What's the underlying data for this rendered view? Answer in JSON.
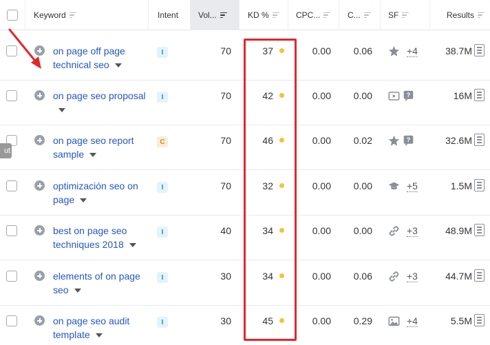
{
  "columns": {
    "keyword": "Keyword",
    "intent": "Intent",
    "volume": "Vol...",
    "kd": "KD %",
    "cpc": "CPC...",
    "competition": "C...",
    "sf": "SF",
    "results": "Results"
  },
  "side_tab_label": "ut",
  "kd_dot_color": "#f5c431",
  "highlight_color": "#e4262c",
  "rows": [
    {
      "keyword": "on page off page technical seo",
      "intent": "I",
      "volume": "70",
      "kd": "37",
      "cpc": "0.00",
      "competition": "0.06",
      "sf_icons": [
        "star-icon"
      ],
      "sf_count": "+4",
      "results": "38.7M"
    },
    {
      "keyword": "on page seo proposal",
      "intent": "I",
      "volume": "70",
      "kd": "42",
      "cpc": "0.00",
      "competition": "0.00",
      "sf_icons": [
        "video-icon",
        "faq-icon"
      ],
      "sf_count": "",
      "results": "16M"
    },
    {
      "keyword": "on page seo report sample",
      "intent": "C",
      "volume": "70",
      "kd": "46",
      "cpc": "0.00",
      "competition": "0.02",
      "sf_icons": [
        "star-icon",
        "faq-icon"
      ],
      "sf_count": "",
      "results": "32.6M"
    },
    {
      "keyword": "optimización seo on page",
      "intent": "I",
      "volume": "70",
      "kd": "32",
      "cpc": "0.00",
      "competition": "0.00",
      "sf_icons": [
        "graduation-cap-icon"
      ],
      "sf_count": "+5",
      "results": "1.5M"
    },
    {
      "keyword": "best on page seo techniques 2018",
      "intent": "I",
      "volume": "40",
      "kd": "34",
      "cpc": "0.00",
      "competition": "0.00",
      "sf_icons": [
        "link-icon"
      ],
      "sf_count": "+3",
      "results": "48.9M"
    },
    {
      "keyword": "elements of on page seo",
      "intent": "I",
      "volume": "30",
      "kd": "34",
      "cpc": "0.00",
      "competition": "0.06",
      "sf_icons": [
        "link-icon"
      ],
      "sf_count": "+3",
      "results": "44.7M"
    },
    {
      "keyword": "on page seo audit template",
      "intent": "I",
      "volume": "30",
      "kd": "45",
      "cpc": "0.00",
      "competition": "0.29",
      "sf_icons": [
        "image-icon"
      ],
      "sf_count": "+4",
      "results": "5.5M"
    }
  ]
}
